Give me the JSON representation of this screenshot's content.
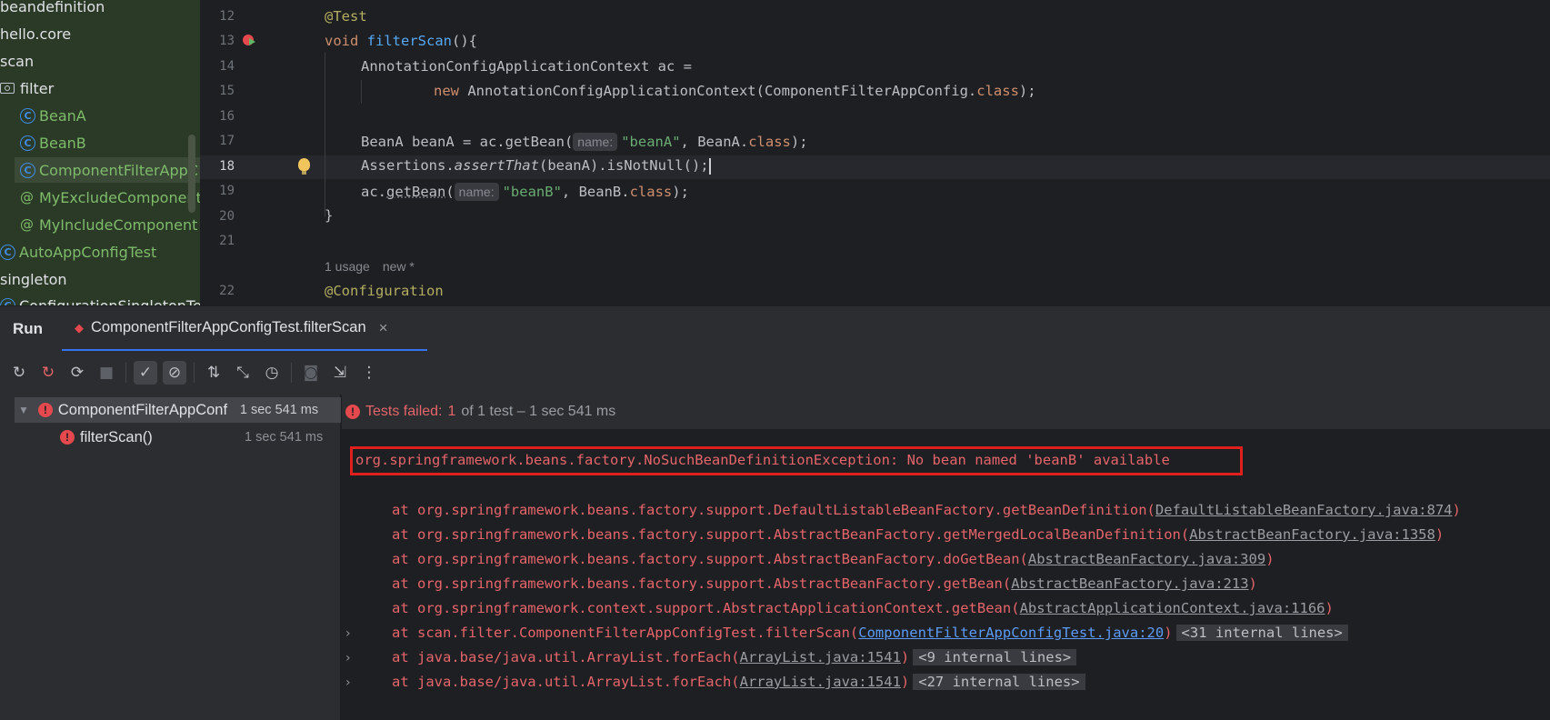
{
  "project_tree": {
    "items": [
      {
        "label": "beandefinition",
        "icon": "none"
      },
      {
        "label": "hello.core",
        "icon": "none"
      },
      {
        "label": "scan",
        "icon": "none"
      },
      {
        "label": "filter",
        "icon": "package-folder-icon"
      },
      {
        "label": "BeanA",
        "icon": "class-icon",
        "icon_glyph": "C"
      },
      {
        "label": "BeanB",
        "icon": "class-icon",
        "icon_glyph": "C"
      },
      {
        "label": "ComponentFilterAppC",
        "icon": "class-icon",
        "icon_glyph": "C",
        "selected": true
      },
      {
        "label": "MyExcludeComponent",
        "icon": "annotation-icon",
        "icon_glyph": "@"
      },
      {
        "label": "MyIncludeComponent",
        "icon": "annotation-icon",
        "icon_glyph": "@"
      },
      {
        "label": "AutoAppConfigTest",
        "icon": "class-icon",
        "icon_glyph": "C"
      },
      {
        "label": "singleton",
        "icon": "none"
      },
      {
        "label": "ConfigurationSingletonTe",
        "icon": "class-icon",
        "icon_glyph": "C"
      }
    ]
  },
  "editor": {
    "line_numbers": [
      "12",
      "13",
      "14",
      "15",
      "16",
      "17",
      "18",
      "19",
      "20",
      "21",
      "22"
    ],
    "current_line": "18",
    "code": {
      "l12_annotation": "@Test",
      "l13_void": "void",
      "l13_name": "filterScan",
      "l13_rest": "(){",
      "l14": "AnnotationConfigApplicationContext ac =",
      "l15_new": "new",
      "l15_rest": " AnnotationConfigApplicationContext(ComponentFilterAppConfig.",
      "l15_class": "class",
      "l15_end": ");",
      "l17_a": "BeanA beanA = ac.getBean(",
      "l17_hint": "name:",
      "l17_str": "\"beanA\"",
      "l17_b": ", BeanA.",
      "l17_class": "class",
      "l17_end": ");",
      "l18_a": "Assertions.",
      "l18_it": "assertThat",
      "l18_b": "(beanA).isNotNull();",
      "l19_a": "ac.",
      "l19_method": "getBean",
      "l19_paren": "(",
      "l19_hint": "name:",
      "l19_str": "\"beanB\"",
      "l19_b": ", BeanB.",
      "l19_class": "class",
      "l19_end": ");",
      "l20": "}",
      "l22_annotation": "@Configuration"
    },
    "usage_hint": {
      "usages": "1 usage",
      "author": "new *"
    }
  },
  "run_window": {
    "title": "Run",
    "tab_label": "ComponentFilterAppConfigTest.filterScan",
    "tab_close": "×",
    "toolbar": [
      {
        "name": "rerun-icon",
        "glyph": "↻"
      },
      {
        "name": "rerun-failed-icon",
        "glyph": "↻"
      },
      {
        "name": "toggle-auto-test-icon",
        "glyph": "⟳"
      },
      {
        "name": "stop-icon",
        "glyph": "■",
        "disabled": true
      },
      {
        "name": "show-passed-icon",
        "glyph": "✓",
        "toggled": true
      },
      {
        "name": "show-ignored-icon",
        "glyph": "⊘",
        "toggled": true
      },
      {
        "name": "sort-icon",
        "glyph": "⇅"
      },
      {
        "name": "collapse-all-icon",
        "glyph": "⤡"
      },
      {
        "name": "test-history-icon",
        "glyph": "◷"
      },
      {
        "name": "screenshot-icon",
        "glyph": "◙",
        "disabled": true
      },
      {
        "name": "export-icon",
        "glyph": "⇲"
      },
      {
        "name": "more-options-icon",
        "glyph": "⋮"
      }
    ],
    "test_tree": [
      {
        "label": "ComponentFilterAppConf",
        "time": "1 sec 541 ms",
        "status": "failed"
      },
      {
        "label": "filterScan()",
        "time": "1 sec 541 ms",
        "status": "failed"
      }
    ],
    "status": {
      "failed_label": "Tests failed:",
      "failed_count": "1",
      "rest": "of 1 test – 1 sec 541 ms"
    },
    "console": {
      "exception": "org.springframework.beans.factory.NoSuchBeanDefinitionException: No bean named 'beanB' available",
      "stack": [
        {
          "text": "at org.springframework.beans.factory.support.DefaultListableBeanFactory.getBeanDefinition(",
          "link": "DefaultListableBeanFactory.java:874",
          "end": ")"
        },
        {
          "text": "at org.springframework.beans.factory.support.AbstractBeanFactory.getMergedLocalBeanDefinition(",
          "link": "AbstractBeanFactory.java:1358",
          "end": ")"
        },
        {
          "text": "at org.springframework.beans.factory.support.AbstractBeanFactory.doGetBean(",
          "link": "AbstractBeanFactory.java:309",
          "end": ")"
        },
        {
          "text": "at org.springframework.beans.factory.support.AbstractBeanFactory.getBean(",
          "link": "AbstractBeanFactory.java:213",
          "end": ")"
        },
        {
          "text": "at org.springframework.context.support.AbstractApplicationContext.getBean(",
          "link": "AbstractApplicationContext.java:1166",
          "end": ")"
        },
        {
          "text": "at scan.filter.ComponentFilterAppConfigTest.filterScan(",
          "link": "ComponentFilterAppConfigTest.java:20",
          "end": ")",
          "fold": "<31 internal lines>",
          "expandable": true
        },
        {
          "text": "at java.base/java.util.ArrayList.forEach(",
          "link": "ArrayList.java:1541",
          "end": ")",
          "fold": "<9 internal lines>",
          "expandable": true
        },
        {
          "text": "at java.base/java.util.ArrayList.forEach(",
          "link": "ArrayList.java:1541",
          "end": ")",
          "fold": "<27 internal lines>",
          "expandable": true
        }
      ],
      "expander_glyph": "›"
    }
  },
  "colors": {
    "error_red": "#e5656a",
    "highlight_box": "#e0201c",
    "link_blue": "#5b9bf7",
    "tree_bg": "#2b3a27",
    "editor_bg": "#1e1f22"
  }
}
